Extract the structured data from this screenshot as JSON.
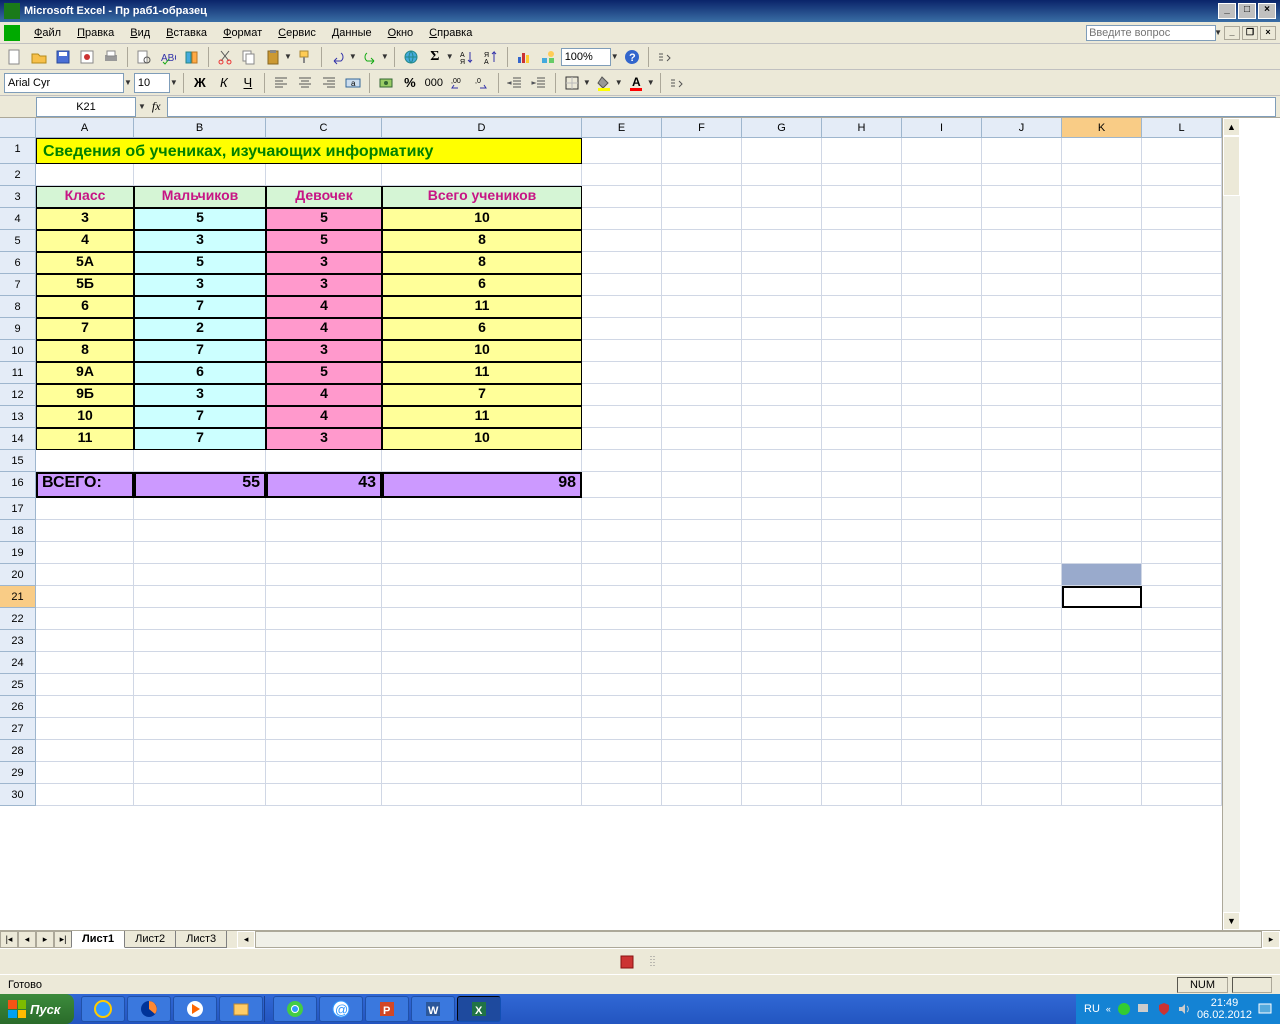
{
  "app": {
    "title": "Microsoft Excel - Пр раб1-образец"
  },
  "menu": {
    "items": [
      "Файл",
      "Правка",
      "Вид",
      "Вставка",
      "Формат",
      "Сервис",
      "Данные",
      "Окно",
      "Справка"
    ],
    "question_placeholder": "Введите вопрос"
  },
  "format": {
    "font": "Arial Cyr",
    "size": "10",
    "zoom": "100%"
  },
  "namebox": "K21",
  "sheet": {
    "columns": [
      "A",
      "B",
      "C",
      "D",
      "E",
      "F",
      "G",
      "H",
      "I",
      "J",
      "K",
      "L"
    ],
    "title": "Сведения об учениках, изучающих информатику",
    "headers": {
      "A": "Класс",
      "B": "Мальчиков",
      "C": "Девочек",
      "D": "Всего учеников"
    },
    "rows": [
      {
        "k": "3",
        "b": "5",
        "g": "5",
        "t": "10"
      },
      {
        "k": "4",
        "b": "3",
        "g": "5",
        "t": "8"
      },
      {
        "k": "5А",
        "b": "5",
        "g": "3",
        "t": "8"
      },
      {
        "k": "5Б",
        "b": "3",
        "g": "3",
        "t": "6"
      },
      {
        "k": "6",
        "b": "7",
        "g": "4",
        "t": "11"
      },
      {
        "k": "7",
        "b": "2",
        "g": "4",
        "t": "6"
      },
      {
        "k": "8",
        "b": "7",
        "g": "3",
        "t": "10"
      },
      {
        "k": "9А",
        "b": "6",
        "g": "5",
        "t": "11"
      },
      {
        "k": "9Б",
        "b": "3",
        "g": "4",
        "t": "7"
      },
      {
        "k": "10",
        "b": "7",
        "g": "4",
        "t": "11"
      },
      {
        "k": "11",
        "b": "7",
        "g": "3",
        "t": "10"
      }
    ],
    "total": {
      "label": "ВСЕГО:",
      "b": "55",
      "g": "43",
      "t": "98"
    },
    "selected_cell": "K21",
    "max_row": 30
  },
  "tabs": {
    "items": [
      "Лист1",
      "Лист2",
      "Лист3"
    ],
    "active": 0
  },
  "status": {
    "ready": "Готово",
    "num": "NUM"
  },
  "taskbar": {
    "start": "Пуск",
    "lang": "RU",
    "time": "21:49",
    "date": "06.02.2012"
  },
  "chart_data": {
    "type": "table",
    "title": "Сведения об учениках, изучающих информатику",
    "columns": [
      "Класс",
      "Мальчиков",
      "Девочек",
      "Всего учеников"
    ],
    "rows": [
      [
        "3",
        5,
        5,
        10
      ],
      [
        "4",
        3,
        5,
        8
      ],
      [
        "5А",
        5,
        3,
        8
      ],
      [
        "5Б",
        3,
        3,
        6
      ],
      [
        "6",
        7,
        4,
        11
      ],
      [
        "7",
        2,
        4,
        6
      ],
      [
        "8",
        7,
        3,
        10
      ],
      [
        "9А",
        6,
        5,
        11
      ],
      [
        "9Б",
        3,
        4,
        7
      ],
      [
        "10",
        7,
        4,
        11
      ],
      [
        "11",
        7,
        3,
        10
      ]
    ],
    "totals": {
      "Мальчиков": 55,
      "Девочек": 43,
      "Всего учеников": 98
    }
  }
}
